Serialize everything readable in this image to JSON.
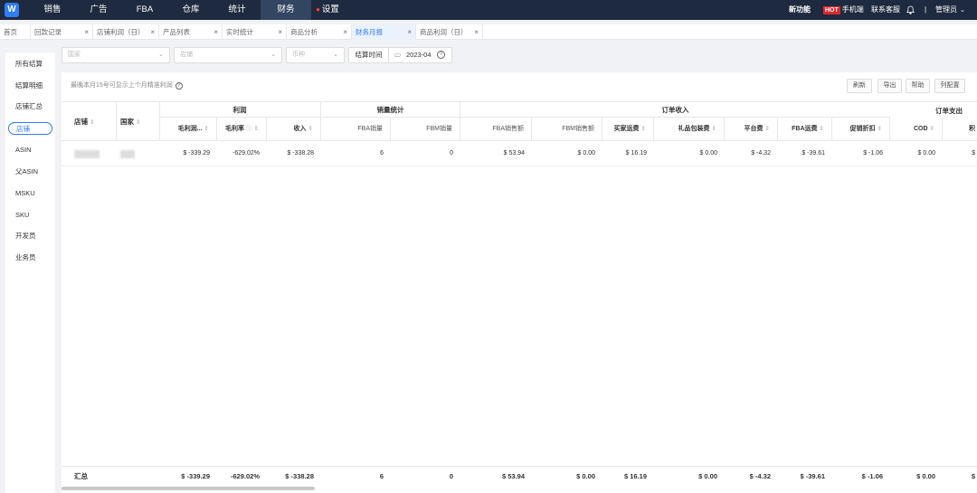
{
  "topnav": {
    "logo_letter": "W",
    "items": [
      {
        "label": "销售"
      },
      {
        "label": "广告"
      },
      {
        "label": "FBA"
      },
      {
        "label": "仓库"
      },
      {
        "label": "统计"
      },
      {
        "label": "财务",
        "active": true
      },
      {
        "label": "设置",
        "dot": true
      }
    ],
    "new_feature": "新功能",
    "hot_badge": "HOT",
    "mobile": "手机端",
    "contact": "联系客服",
    "divider": "|",
    "user": "管理员"
  },
  "tabs": [
    {
      "label": "首页",
      "closable": false
    },
    {
      "label": "回款记录",
      "closable": true
    },
    {
      "label": "店铺利润（日）",
      "closable": true
    },
    {
      "label": "产品列表",
      "closable": true
    },
    {
      "label": "实时统计",
      "closable": true
    },
    {
      "label": "商品分析",
      "closable": true
    },
    {
      "label": "财务月报",
      "closable": true,
      "active": true
    },
    {
      "label": "商品利润（日）",
      "closable": true
    }
  ],
  "sidebar": {
    "items": [
      {
        "label": "所有结算"
      },
      {
        "label": "结算明细"
      },
      {
        "label": "店铺汇总"
      },
      {
        "label": "店铺",
        "active": true
      },
      {
        "label": "ASIN"
      },
      {
        "label": "父ASIN"
      },
      {
        "label": "MSKU"
      },
      {
        "label": "SKU"
      },
      {
        "label": "开发员"
      },
      {
        "label": "业务员"
      }
    ]
  },
  "filters": {
    "country_placeholder": "国家",
    "shop_placeholder": "店铺",
    "currency_placeholder": "币种",
    "date_label": "结算时间",
    "date_value": "2023-04"
  },
  "toolbar": {
    "tip": "最晚本月15号可显示上个月精准利润",
    "refresh": "刷新",
    "export": "导出",
    "help": "帮助",
    "columns": "列配置"
  },
  "table": {
    "col_shop": "店铺",
    "col_country": "国家",
    "groups": {
      "profit": "利润",
      "sales": "销量统计",
      "order_income": "订单收入",
      "order_expense": "订单支出"
    },
    "headers": {
      "gross_profit": "毛利润...",
      "margin": "毛利率",
      "income": "收入",
      "fba_qty": "FBA销量",
      "fbm_qty": "FBM销量",
      "fba_sales": "FBA销售额",
      "fbm_sales": "FBM销售额",
      "buyer_shipping": "买家运费",
      "gift_wrap": "礼品包装费",
      "platform_fee": "平台费",
      "fba_shipping": "FBA运费",
      "promo": "促销折扣",
      "cod": "COD",
      "more": "积"
    },
    "row": {
      "gross_profit": "$ -339.29",
      "margin": "-629.02%",
      "income": "$ -338.28",
      "fba_qty": "6",
      "fbm_qty": "0",
      "fba_sales": "$ 53.94",
      "fbm_sales": "$ 0.00",
      "buyer_shipping": "$ 16.19",
      "gift_wrap": "$ 0.00",
      "platform_fee": "$ -4.32",
      "fba_shipping": "$ -39.61",
      "promo": "$ -1.06",
      "cod": "$ 0.00",
      "more": "$"
    },
    "footer": {
      "label": "汇总",
      "gross_profit": "$ -339.29",
      "margin": "-629.02%",
      "income": "$ -338.28",
      "fba_qty": "6",
      "fbm_qty": "0",
      "fba_sales": "$ 53.94",
      "fbm_sales": "$ 0.00",
      "buyer_shipping": "$ 16.19",
      "gift_wrap": "$ 0.00",
      "platform_fee": "$ -4.32",
      "fba_shipping": "$ -39.61",
      "promo": "$ -1.06",
      "cod": "$ 0.00",
      "more": "$"
    }
  }
}
